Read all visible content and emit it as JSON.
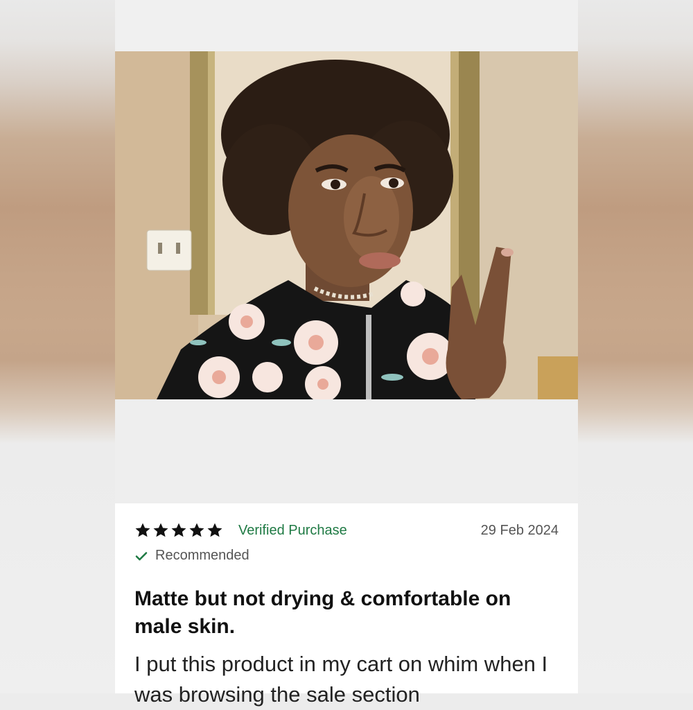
{
  "review": {
    "rating": 5,
    "rating_max": 5,
    "verified_label": "Verified Purchase",
    "date": "29 Feb 2024",
    "recommended_label": "Recommended",
    "title": "Matte but not drying & comfortable on male skin.",
    "body": "I put this product in my cart on whim when I was browsing the sale section",
    "photo_icon": "review-photo"
  },
  "colors": {
    "verified_green": "#1f7a44",
    "star": "#111111",
    "date_gray": "#555555"
  }
}
